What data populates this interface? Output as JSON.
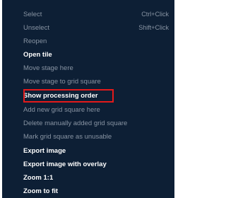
{
  "menu": {
    "items": [
      {
        "label": "Select",
        "shortcut": "Ctrl+Click",
        "enabled": false
      },
      {
        "label": "Unselect",
        "shortcut": "Shift+Click",
        "enabled": false
      },
      {
        "label": "Reopen",
        "shortcut": "",
        "enabled": false
      },
      {
        "label": "Open tile",
        "shortcut": "",
        "enabled": true
      },
      {
        "label": "Move stage here",
        "shortcut": "",
        "enabled": false
      },
      {
        "label": "Move stage to grid square",
        "shortcut": "",
        "enabled": false
      },
      {
        "label": "Show processing order",
        "shortcut": "",
        "enabled": true
      },
      {
        "label": "Add new grid square here",
        "shortcut": "",
        "enabled": false
      },
      {
        "label": "Delete manually added grid square",
        "shortcut": "",
        "enabled": false
      },
      {
        "label": "Mark grid square as unusable",
        "shortcut": "",
        "enabled": false
      },
      {
        "label": "Export image",
        "shortcut": "",
        "enabled": true
      },
      {
        "label": "Export image with overlay",
        "shortcut": "",
        "enabled": true
      },
      {
        "label": "Zoom 1:1",
        "shortcut": "",
        "enabled": true
      },
      {
        "label": "Zoom to fit",
        "shortcut": "",
        "enabled": true
      }
    ],
    "highlighted_item": "Show processing order",
    "highlight_color": "#e31a1a",
    "background_color": "#0d1f35"
  }
}
